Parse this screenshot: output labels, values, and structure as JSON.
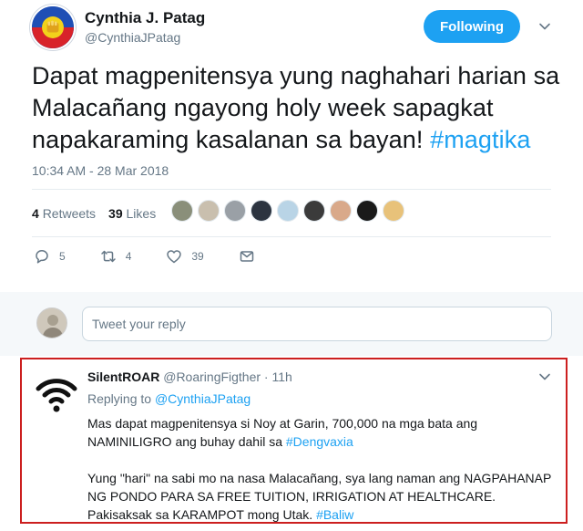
{
  "tweet": {
    "author_name": "Cynthia J. Patag",
    "author_handle": "@CynthiaJPatag",
    "follow_label": "Following",
    "text_main": "Dapat magpenitensya yung naghahari harian sa Malacañang ngayong holy week sapagkat napakaraming kasalanan sa bayan! ",
    "hashtag": "#magtika",
    "timestamp": "10:34 AM - 28 Mar 2018",
    "retweets_count": "4",
    "retweets_label": "Retweets",
    "likes_count": "39",
    "likes_label": "Likes",
    "likers": [
      "#8a8f7a",
      "#c9bfae",
      "#9aa0a6",
      "#2c3440",
      "#b9d4e6",
      "#3b3b3b",
      "#d9a98a",
      "#1a1a1a",
      "#e8c27a"
    ],
    "actions": {
      "reply_count": "5",
      "retweet_count": "4",
      "like_count": "39"
    },
    "icons": [
      "reply-icon",
      "retweet-icon",
      "like-icon",
      "message-icon",
      "chevron-down-icon"
    ]
  },
  "reply_box": {
    "placeholder": "Tweet your reply"
  },
  "reply": {
    "name": "SilentROAR",
    "handle": "@RoaringFigther",
    "separator": " · ",
    "time": "11h",
    "replying_prefix": "Replying to ",
    "replying_to": "@CynthiaJPatag",
    "para1_text": "Mas dapat magpenitensya si Noy at Garin, 700,000 na mga bata ang NAMINILIGRO ang buhay dahil sa ",
    "para1_hashtag": "#Dengvaxia",
    "para2_text": "Yung \"hari\" na sabi mo na nasa Malacañang, sya lang naman ang NAGPAHANAP NG PONDO PARA SA FREE TUITION, IRRIGATION AT HEALTHCARE. Pakisaksak sa KARAMPOT mong Utak. ",
    "para2_hashtag": "#Baliw"
  },
  "colors": {
    "accent": "#1da1f2",
    "text": "#14171a",
    "muted": "#657786",
    "highlight_border": "#cc1f1f"
  }
}
